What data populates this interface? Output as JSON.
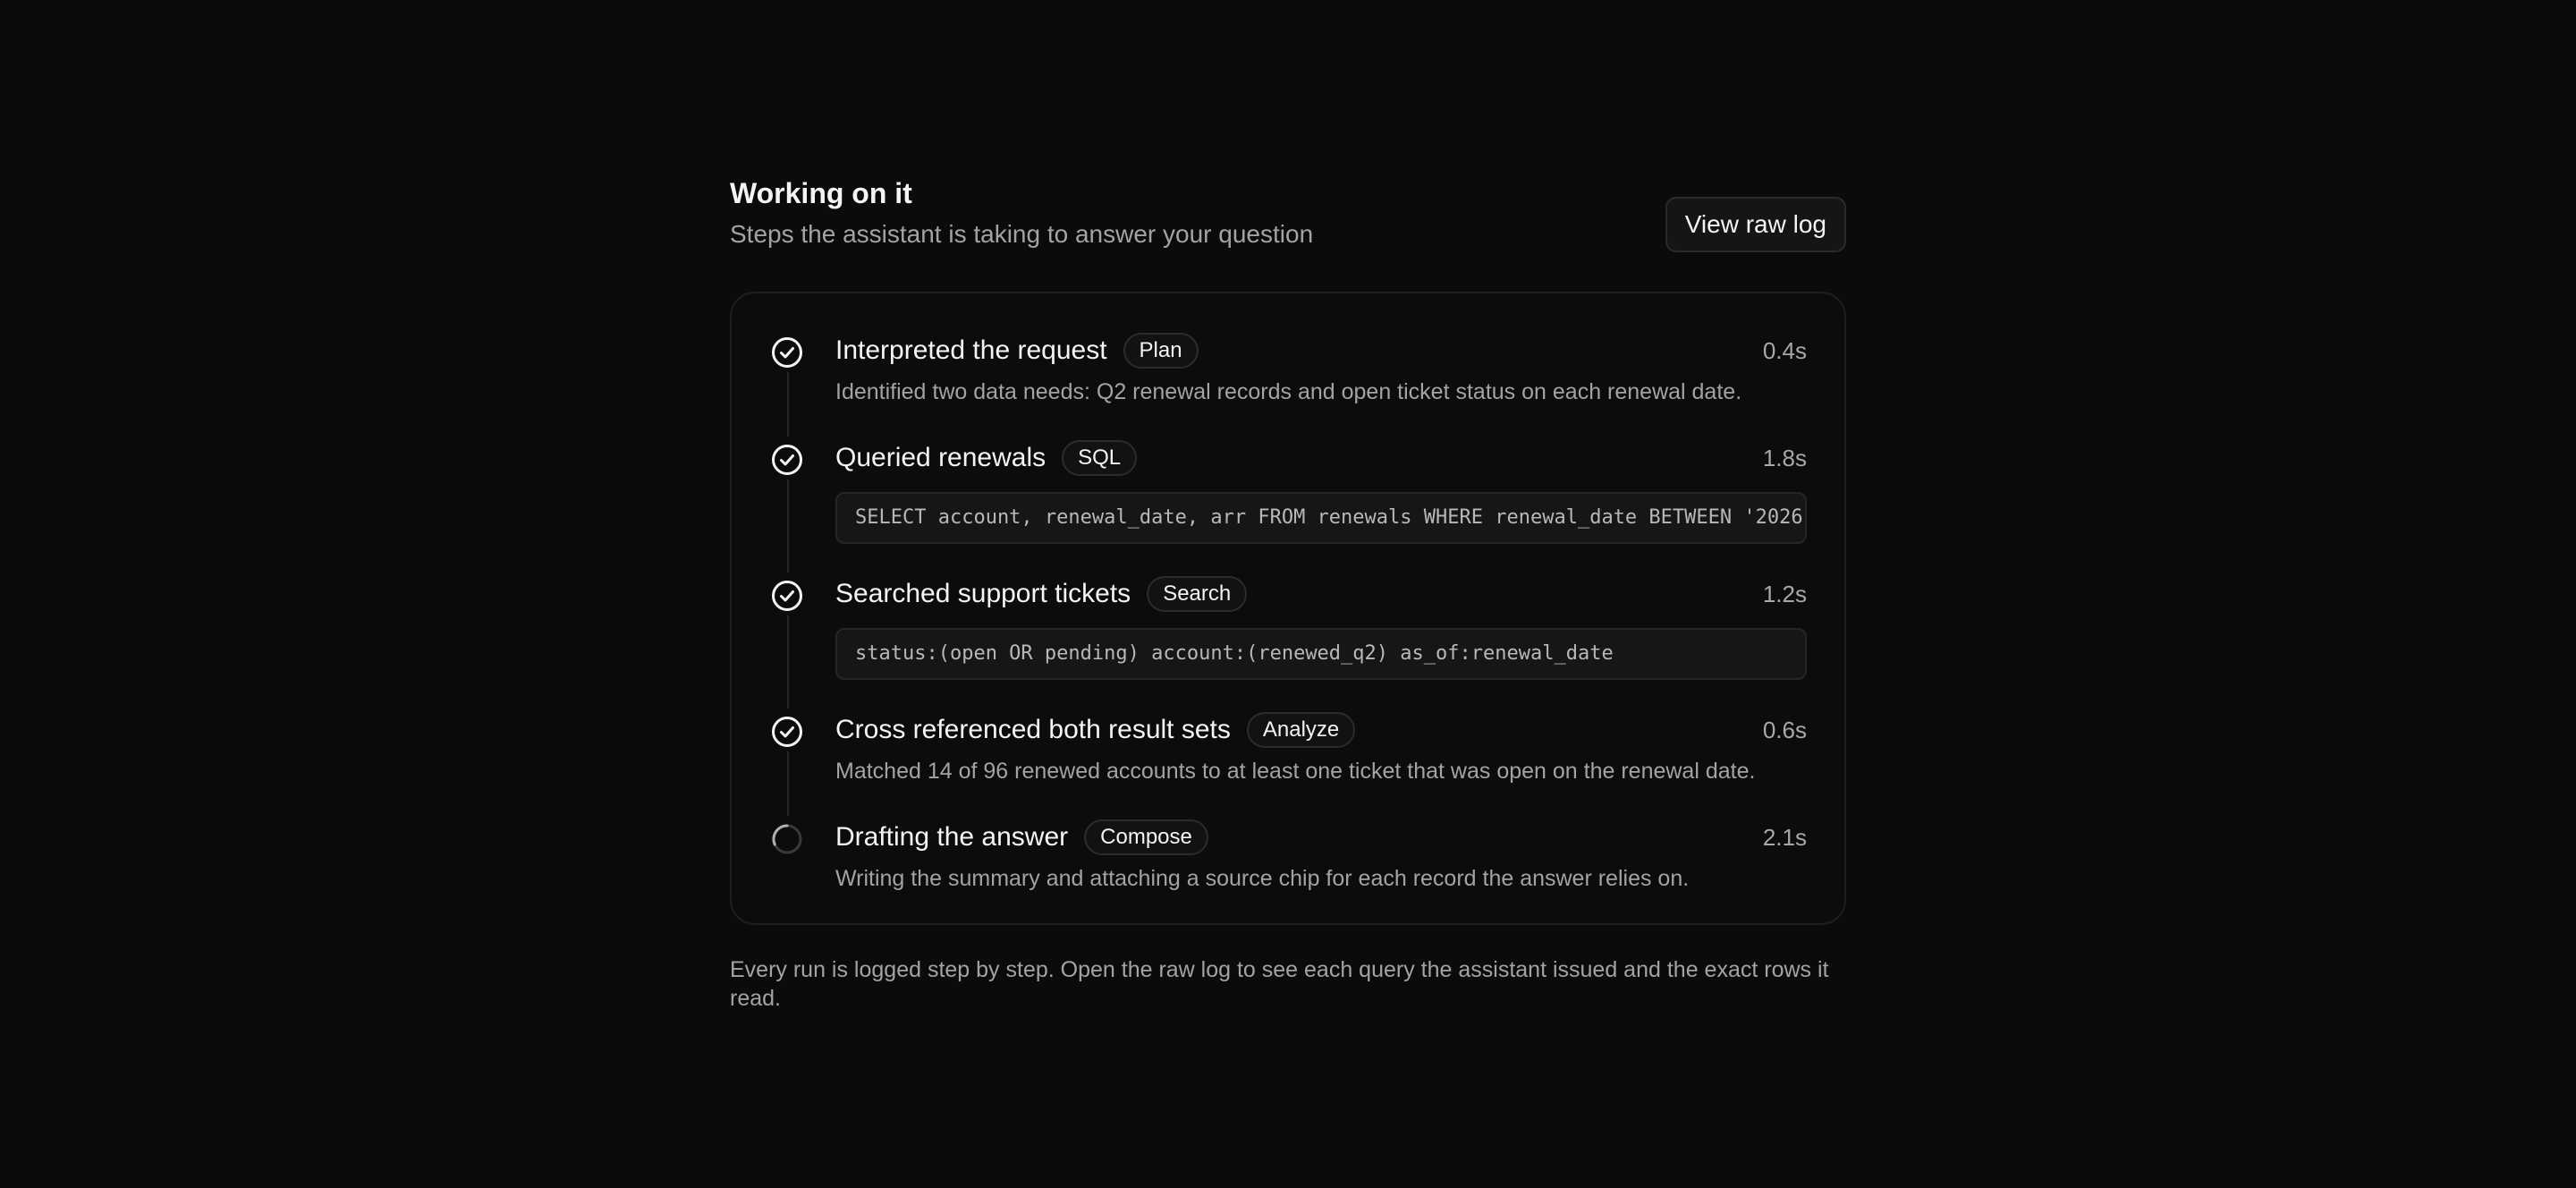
{
  "header": {
    "title": "Working on it",
    "subtitle": "Steps the assistant is taking to answer your question",
    "view_raw_log_label": "View raw log"
  },
  "steps": [
    {
      "title": "Interpreted the request",
      "chip": "Plan",
      "duration": "0.4s",
      "description": "Identified two data needs: Q2 renewal records and open ticket status on each renewal date.",
      "status": "done",
      "status_icon": "check-circle-icon"
    },
    {
      "title": "Queried renewals",
      "chip": "SQL",
      "duration": "1.8s",
      "code": "SELECT account, renewal_date, arr FROM renewals WHERE renewal_date BETWEEN '2026-",
      "status": "done",
      "status_icon": "check-circle-icon"
    },
    {
      "title": "Searched support tickets",
      "chip": "Search",
      "duration": "1.2s",
      "code": "status:(open OR pending) account:(renewed_q2) as_of:renewal_date",
      "status": "done",
      "status_icon": "check-circle-icon"
    },
    {
      "title": "Cross referenced both result sets",
      "chip": "Analyze",
      "duration": "0.6s",
      "description": "Matched 14 of 96 renewed accounts to at least one ticket that was open on the renewal date.",
      "status": "done",
      "status_icon": "check-circle-icon"
    },
    {
      "title": "Drafting the answer",
      "chip": "Compose",
      "duration": "2.1s",
      "description": "Writing the summary and attaching a source chip for each record the answer relies on.",
      "status": "in-progress",
      "status_icon": "spinner-icon"
    }
  ],
  "footnote": "Every run is logged step by step. Open the raw log to see each query the assistant issued and the exact rows it read.",
  "colors": {
    "background": "#0b0b0b",
    "text_primary": "#f4f4f4",
    "text_secondary": "#a3a3a3",
    "border": "#262626"
  }
}
